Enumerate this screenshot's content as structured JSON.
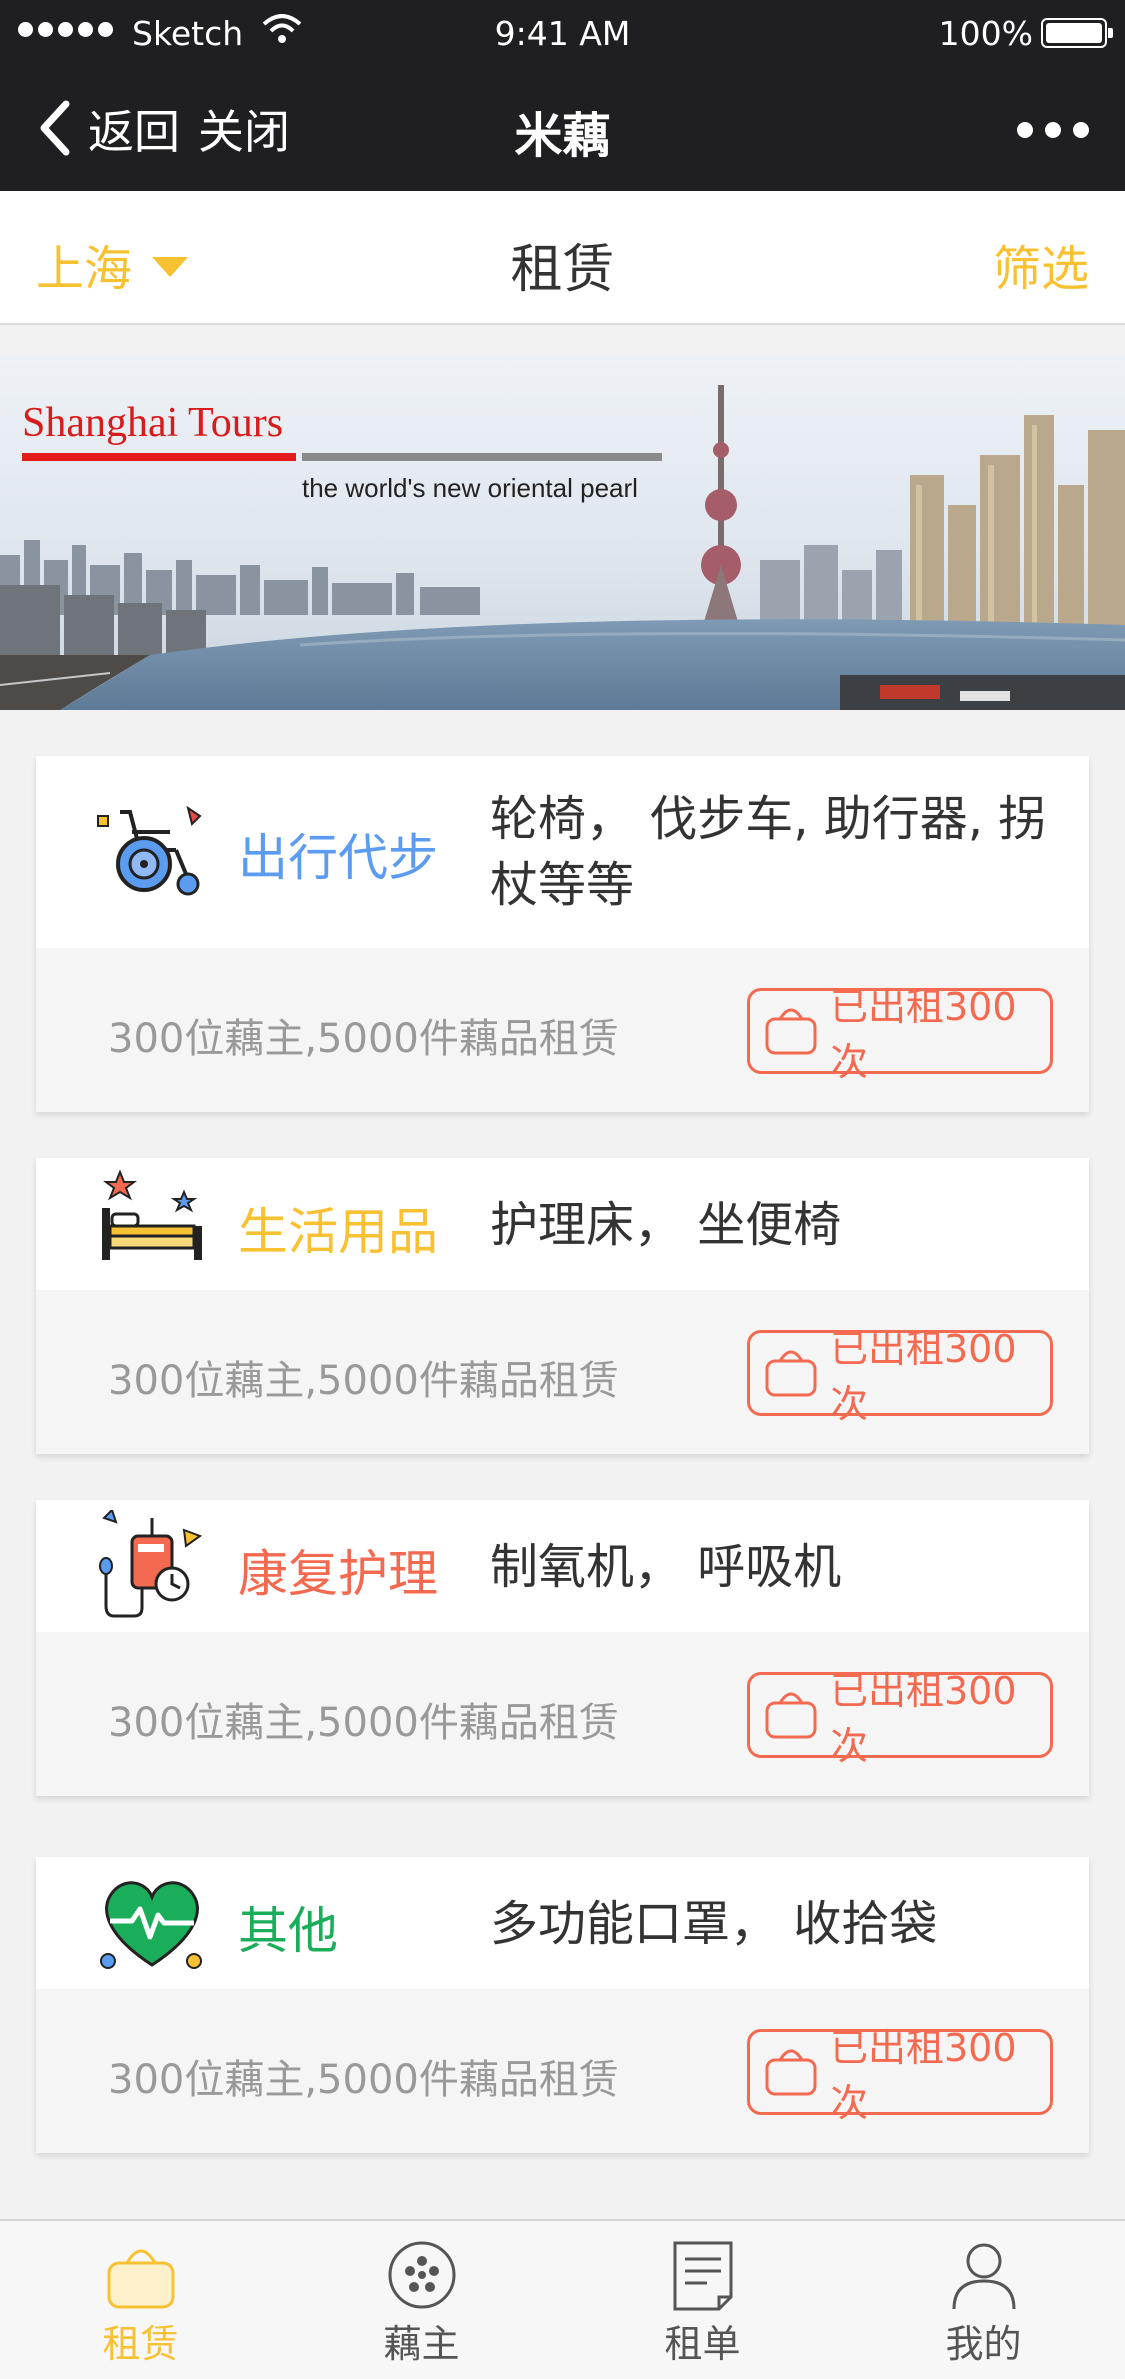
{
  "status_bar": {
    "carrier": "Sketch",
    "time": "9:41 AM",
    "battery": "100%"
  },
  "nav": {
    "back_label": "返回",
    "close_label": "关闭",
    "title": "米藕"
  },
  "subheader": {
    "city": "上海",
    "title": "租赁",
    "filter": "筛选"
  },
  "banner": {
    "heading": "Shanghai Tours",
    "tagline": "the world's new oriental pearl"
  },
  "colors": {
    "accent": "#f7c132",
    "topbar": "#1f1f21",
    "badge": "#f36a50",
    "travel": "#5b9bf0",
    "living": "#f7c132",
    "rehab": "#f36a50",
    "other": "#1aad5a"
  },
  "categories": [
    {
      "name": "出行代步",
      "desc": "轮椅， 伐步车, 助行器, 拐杖等等",
      "stat": "300位藕主,5000件藕品租赁",
      "badge": "已出租300次",
      "icon": "wheelchair-icon"
    },
    {
      "name": "生活用品",
      "desc": "护理床， 坐便椅",
      "stat": "300位藕主,5000件藕品租赁",
      "badge": "已出租300次",
      "icon": "bed-icon"
    },
    {
      "name": "康复护理",
      "desc": "制氧机， 呼吸机",
      "stat": "300位藕主,5000件藕品租赁",
      "badge": "已出租300次",
      "icon": "medical-device-icon"
    },
    {
      "name": "其他",
      "desc": "多功能口罩， 收拾袋",
      "stat": "300位藕主,5000件藕品租赁",
      "badge": "已出租300次",
      "icon": "heart-pulse-icon"
    }
  ],
  "tabbar": [
    {
      "label": "租赁",
      "icon": "bag-icon",
      "active": true
    },
    {
      "label": "藕主",
      "icon": "lotus-icon",
      "active": false
    },
    {
      "label": "租单",
      "icon": "order-icon",
      "active": false
    },
    {
      "label": "我的",
      "icon": "person-icon",
      "active": false
    }
  ]
}
